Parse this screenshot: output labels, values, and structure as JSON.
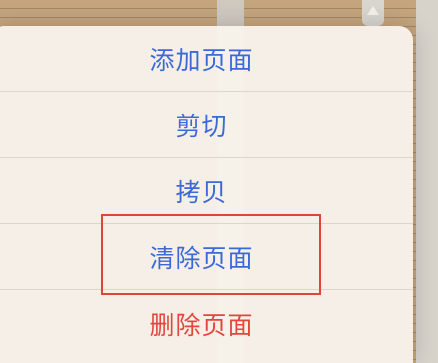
{
  "menu": {
    "items": [
      {
        "label": "添加页面",
        "style": "normal"
      },
      {
        "label": "剪切",
        "style": "normal"
      },
      {
        "label": "拷贝",
        "style": "normal"
      },
      {
        "label": "清除页面",
        "style": "normal",
        "highlighted": true
      },
      {
        "label": "删除页面",
        "style": "destructive"
      }
    ]
  },
  "colors": {
    "action_blue": "#3b6ad8",
    "destructive_red": "#e3463c",
    "highlight_box": "#e2433a",
    "menu_background": "#f7f2ea",
    "paper": "#c4a57e"
  },
  "icons": {
    "scroll_up": "chevron-up-icon"
  }
}
